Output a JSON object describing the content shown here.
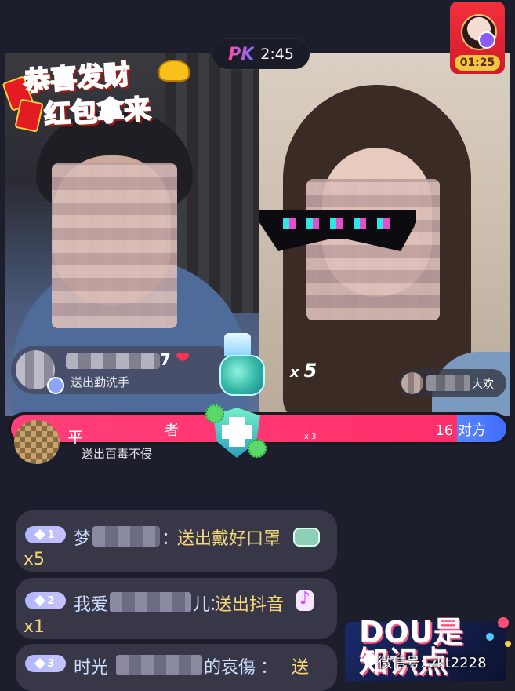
{
  "pk": {
    "badge": "PK",
    "time": "2:45"
  },
  "red_packet": {
    "countdown": "01:25"
  },
  "sticker": {
    "line1": "恭喜发财",
    "line2": "红包拿来"
  },
  "gift_card_top": {
    "name_suffix": "7",
    "action": "送出勤洗手"
  },
  "gift_combo": {
    "x": "x",
    "count": "5"
  },
  "gift_card_right": {
    "label": "大欢"
  },
  "pk_bar": {
    "left_label": "者",
    "right_score": "16",
    "right_label": "对方",
    "multiplier": "x 3",
    "left_fraction": 0.9,
    "right_fraction": 0.1
  },
  "gift_card_bottom": {
    "name": "平",
    "action": "送出百毒不侵"
  },
  "chat": [
    {
      "level": "1",
      "user_prefix": "梦",
      "colon": "：",
      "message": "送出戴好口罩",
      "qty": "x5"
    },
    {
      "level": "2",
      "user_prefix": "我爱",
      "user_suffix": "儿",
      "colon": "：",
      "message": "送出抖音",
      "qty": "x1"
    },
    {
      "level": "3",
      "user_prefix": "时光",
      "user_suffix": "的哀傷",
      "colon": "：",
      "message": "送"
    }
  ],
  "promo": {
    "text": "DOU是",
    "text2": "知识点",
    "watermark": "微信号: zkt2228"
  },
  "colors": {
    "background": "#1c1f2b",
    "pk_red": "#ff2f6a",
    "pk_blue": "#3f6cff",
    "gold": "#f6d77a"
  }
}
